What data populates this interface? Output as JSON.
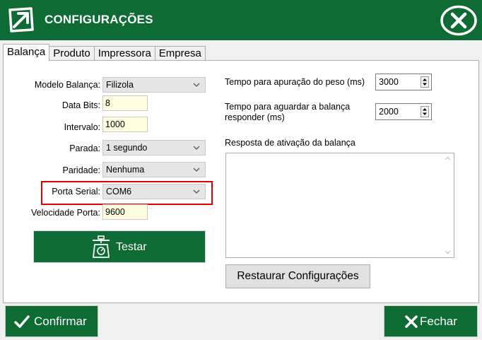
{
  "window": {
    "title": "CONFIGURAÇÕES",
    "logo_icon": "arrow-box-logo",
    "close_icon": "close-circle-icon"
  },
  "colors": {
    "brand_green": "#0d6b33",
    "highlight_red": "#e00000",
    "input_yellow": "#ffffe0"
  },
  "tabs": [
    {
      "label": "Balança",
      "active": true
    },
    {
      "label": "Produto",
      "active": false
    },
    {
      "label": "Impressora",
      "active": false
    },
    {
      "label": "Empresa",
      "active": false
    }
  ],
  "form": {
    "modelo_balanca": {
      "label": "Modelo Balança:",
      "value": "Filizola"
    },
    "data_bits": {
      "label": "Data Bits:",
      "value": "8"
    },
    "intervalo": {
      "label": "Intervalo:",
      "value": "1000"
    },
    "parada": {
      "label": "Parada:",
      "value": "1 segundo"
    },
    "paridade": {
      "label": "Paridade:",
      "value": "Nenhuma"
    },
    "porta_serial": {
      "label": "Porta Serial:",
      "value": "COM6"
    },
    "velocidade_porta": {
      "label": "Velocidade Porta:",
      "value": "9600"
    }
  },
  "testar_button": {
    "label": "Testar",
    "icon": "scale-icon"
  },
  "right": {
    "tempo_apuracao": {
      "label": "Tempo para apuração do peso (ms)",
      "value": "3000"
    },
    "tempo_aguardar": {
      "label_line1": "Tempo para aguardar a balança",
      "label_line2": "responder (ms)",
      "value": "2000"
    },
    "resposta": {
      "label": "Resposta de ativação da balança",
      "value": ""
    }
  },
  "restore_button": {
    "label": "Restaurar Configurações"
  },
  "footer": {
    "confirm": {
      "label": "Confirmar",
      "icon": "check-icon"
    },
    "close": {
      "label": "Fechar",
      "icon": "x-icon"
    }
  }
}
